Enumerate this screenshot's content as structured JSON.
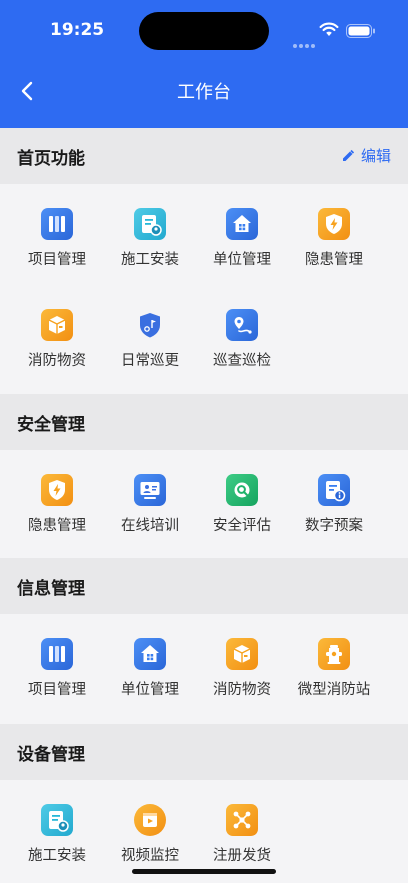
{
  "status_bar": {
    "time": "19:25"
  },
  "header": {
    "title": "工作台"
  },
  "colors": {
    "brand": "#2e6bf2",
    "icon_blue": "#3a7ff0",
    "icon_orange": "#f7a21e",
    "icon_teal": "#27b8d8",
    "icon_green": "#1fb36b"
  },
  "sections": {
    "home": {
      "title": "首页功能",
      "edit_label": "编辑",
      "items": [
        {
          "label": "项目管理",
          "icon": "book-icon"
        },
        {
          "label": "施工安装",
          "icon": "document-user-icon"
        },
        {
          "label": "单位管理",
          "icon": "house-icon"
        },
        {
          "label": "隐患管理",
          "icon": "shield-bolt-icon"
        },
        {
          "label": "消防物资",
          "icon": "box-icon"
        },
        {
          "label": "日常巡更",
          "icon": "shield-flag-icon"
        },
        {
          "label": "巡查巡检",
          "icon": "map-pin-route-icon"
        }
      ]
    },
    "safety": {
      "title": "安全管理",
      "items": [
        {
          "label": "隐患管理",
          "icon": "shield-bolt-icon"
        },
        {
          "label": "在线培训",
          "icon": "monitor-person-icon"
        },
        {
          "label": "安全评估",
          "icon": "magnifier-icon"
        },
        {
          "label": "数字预案",
          "icon": "document-info-icon"
        }
      ]
    },
    "info": {
      "title": "信息管理",
      "items": [
        {
          "label": "项目管理",
          "icon": "book-icon"
        },
        {
          "label": "单位管理",
          "icon": "house-icon"
        },
        {
          "label": "消防物资",
          "icon": "box-icon"
        },
        {
          "label": "微型消防站",
          "icon": "fire-hydrant-icon"
        }
      ]
    },
    "device": {
      "title": "设备管理",
      "items": [
        {
          "label": "施工安装",
          "icon": "document-user-icon"
        },
        {
          "label": "视频监控",
          "icon": "video-icon"
        },
        {
          "label": "注册发货",
          "icon": "network-icon"
        }
      ]
    }
  }
}
